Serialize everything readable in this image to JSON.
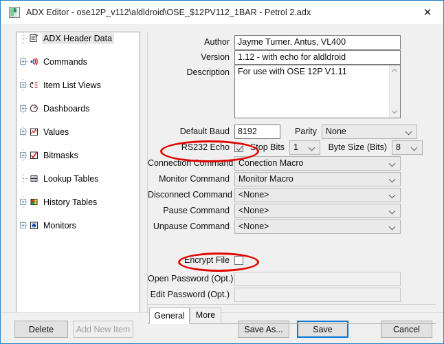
{
  "window": {
    "title": "ADX Editor - ose12P_v112\\aldldroid\\OSE_$12PV112_1BAR - Petrol 2.adx",
    "app_icon": "adx-app-icon",
    "close_label": "✕"
  },
  "tree": {
    "items": [
      {
        "label": "ADX Header Data",
        "icon": "header-data-icon",
        "expandable": false,
        "selected": true
      },
      {
        "label": "Commands",
        "icon": "commands-icon",
        "expandable": true,
        "selected": false
      },
      {
        "label": "Item List Views",
        "icon": "item-list-views-icon",
        "expandable": true,
        "selected": false
      },
      {
        "label": "Dashboards",
        "icon": "dashboards-icon",
        "expandable": true,
        "selected": false
      },
      {
        "label": "Values",
        "icon": "values-icon",
        "expandable": true,
        "selected": false
      },
      {
        "label": "Bitmasks",
        "icon": "bitmasks-icon",
        "expandable": true,
        "selected": false
      },
      {
        "label": "Lookup Tables",
        "icon": "lookup-tables-icon",
        "expandable": false,
        "selected": false
      },
      {
        "label": "History Tables",
        "icon": "history-tables-icon",
        "expandable": true,
        "selected": false
      },
      {
        "label": "Monitors",
        "icon": "monitors-icon",
        "expandable": true,
        "selected": false
      }
    ],
    "expander_glyph": "+"
  },
  "form": {
    "author": {
      "label": "Author",
      "value": "Jayme Turner, Antus, VL400"
    },
    "version": {
      "label": "Version",
      "value": "1.12 - with echo for aldldroid"
    },
    "description": {
      "label": "Description",
      "value": "For use with OSE 12P V1.11"
    },
    "default_baud": {
      "label": "Default Baud",
      "value": "8192"
    },
    "parity": {
      "label": "Parity",
      "value": "None"
    },
    "rs232_echo": {
      "label": "RS232 Echo",
      "checked": true
    },
    "stop_bits": {
      "label": "Stop Bits",
      "value": "1"
    },
    "byte_size": {
      "label": "Byte Size (Bits)",
      "value": "8"
    },
    "connection_command": {
      "label": "Connection Command",
      "value": "Conection Macro"
    },
    "monitor_command": {
      "label": "Monitor Command",
      "value": "Monitor Macro"
    },
    "disconnect_command": {
      "label": "Disconnect Command",
      "value": "<None>"
    },
    "pause_command": {
      "label": "Pause Command",
      "value": "<None>"
    },
    "unpause_command": {
      "label": "Unpause Command",
      "value": "<None>"
    },
    "encrypt_file": {
      "label": "Encrypt File",
      "checked": false
    },
    "open_password": {
      "label": "Open Password (Opt.)",
      "value": "",
      "placeholder": ""
    },
    "edit_password": {
      "label": "Edit Password (Opt.)",
      "value": "",
      "placeholder": ""
    }
  },
  "tabs": [
    {
      "label": "General",
      "active": true
    },
    {
      "label": "More",
      "active": false
    }
  ],
  "buttons": {
    "delete": "Delete",
    "add_new_item": "Add New Item",
    "save_as": "Save As...",
    "save": "Save",
    "cancel": "Cancel"
  },
  "annotations": {
    "color": "#e10600",
    "items": [
      {
        "name": "rs232-echo-highlight"
      },
      {
        "name": "encrypt-file-highlight"
      }
    ]
  }
}
